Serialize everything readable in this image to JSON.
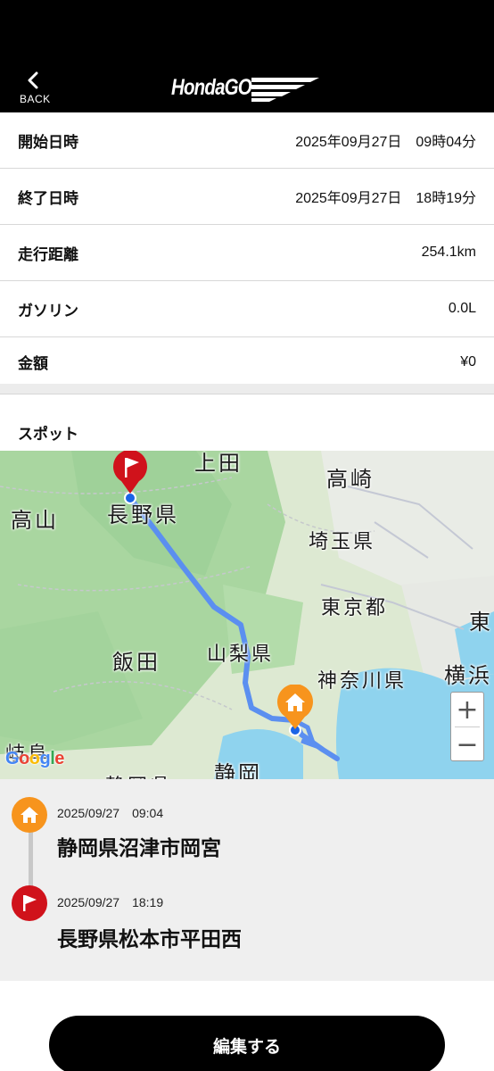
{
  "header": {
    "back_label": "BACK",
    "logo_text": "HondaGO"
  },
  "details": [
    {
      "label": "開始日時",
      "value": "2025年09月27日　09時04分"
    },
    {
      "label": "終了日時",
      "value": "2025年09月27日　18時19分"
    },
    {
      "label": "走行距離",
      "value": "254.1km"
    },
    {
      "label": "ガソリン",
      "value": "0.0L"
    },
    {
      "label": "金額",
      "value": "¥0"
    }
  ],
  "spot": {
    "title": "スポット"
  },
  "map": {
    "labels": [
      "上田",
      "高崎",
      "長野県",
      "高山",
      "埼玉県",
      "東京都",
      "東",
      "飯田",
      "山梨県",
      "神奈川県",
      "横浜",
      "静岡",
      "岐阜",
      "静岡県"
    ],
    "zoom_in": "+",
    "zoom_out": "−",
    "attribution": "Google",
    "route_color": "#5b8ff0",
    "start_marker_color": "#f7941d",
    "end_marker_color": "#d0121b"
  },
  "timeline": [
    {
      "type": "start",
      "icon": "home-icon",
      "date": "2025/09/27　09:04",
      "place": "静岡県沼津市岡宮"
    },
    {
      "type": "end",
      "icon": "flag-icon",
      "date": "2025/09/27　18:19",
      "place": "長野県松本市平田西"
    }
  ],
  "actions": {
    "edit_label": "編集する"
  }
}
